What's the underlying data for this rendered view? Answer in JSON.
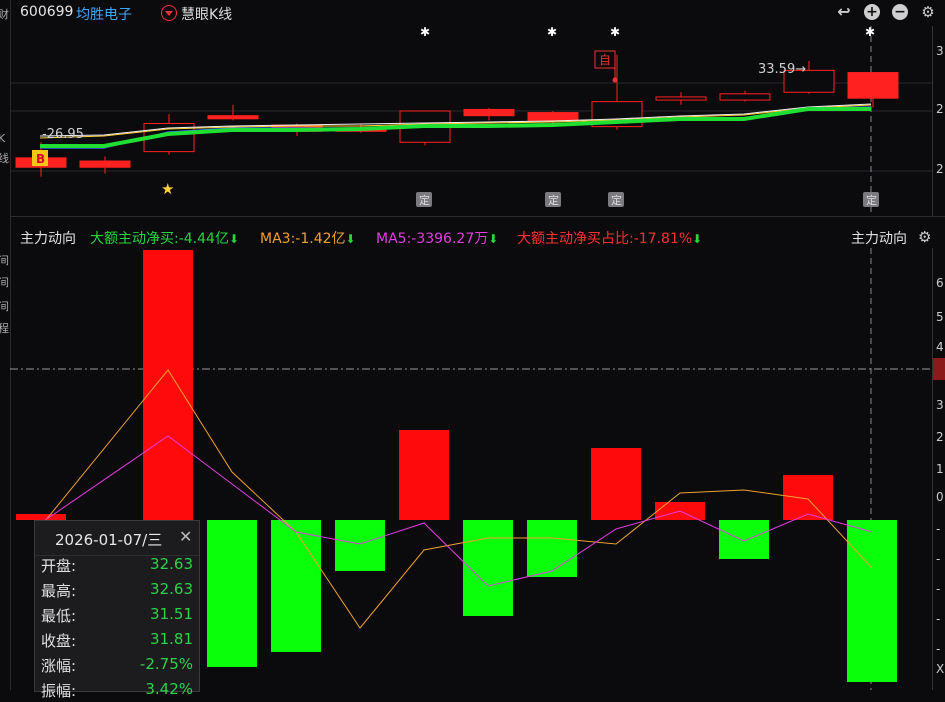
{
  "header": {
    "stock_code": "600699",
    "stock_name": "均胜电子",
    "kline_mode_label": "慧眼K线"
  },
  "left_strip": {
    "glyphs": [
      "财",
      "K",
      "线",
      "间",
      "间",
      "间",
      "程"
    ]
  },
  "kline": {
    "low_marker": "-26.95",
    "high_marker": "33.59→",
    "buy_badge": "B",
    "self_badge": "自",
    "event_badge": "定",
    "axis_labels": [
      "3",
      "2",
      "2"
    ],
    "candles": [
      {
        "o": 29.9,
        "c": 29.6,
        "h": 30.4,
        "l": 29.3
      },
      {
        "o": 29.8,
        "c": 29.6,
        "h": 29.95,
        "l": 29.4
      },
      {
        "o": 30.1,
        "c": 31.0,
        "h": 31.3,
        "l": 30.0
      },
      {
        "o": 31.25,
        "c": 31.15,
        "h": 31.6,
        "l": 31.1
      },
      {
        "o": 30.95,
        "c": 30.75,
        "h": 31.0,
        "l": 30.6
      },
      {
        "o": 30.85,
        "c": 30.75,
        "h": 31.0,
        "l": 30.7
      },
      {
        "o": 30.4,
        "c": 31.4,
        "h": 31.4,
        "l": 30.3
      },
      {
        "o": 31.45,
        "c": 31.25,
        "h": 31.5,
        "l": 31.1
      },
      {
        "o": 31.35,
        "c": 31.1,
        "h": 31.4,
        "l": 31.0
      },
      {
        "o": 30.9,
        "c": 31.7,
        "h": 33.2,
        "l": 30.8
      },
      {
        "o": 31.75,
        "c": 31.85,
        "h": 32.0,
        "l": 31.6
      },
      {
        "o": 31.75,
        "c": 31.95,
        "h": 32.05,
        "l": 31.7
      },
      {
        "o": 32.0,
        "c": 32.7,
        "h": 33.0,
        "l": 31.95
      },
      {
        "o": 32.63,
        "c": 31.81,
        "h": 32.63,
        "l": 31.51
      }
    ]
  },
  "indicator": {
    "title": "主力动向",
    "right_title": "主力动向",
    "net_buy_label": "大额主动净买:-4.44亿",
    "ma3_label": "MA3:-1.42亿",
    "ma5_label": "MA5:-3396.27万",
    "ratio_label": "大额主动净买占比:-17.81%",
    "axis_labels": [
      "6",
      "5",
      "4",
      "3",
      "2",
      "1",
      "0",
      "-",
      "-",
      "-",
      "-",
      "-",
      "X"
    ],
    "bars": [
      0.2,
      -4.7,
      -4.4,
      -1.7,
      3.0,
      -3.2,
      -1.9,
      2.4,
      0.6,
      -1.3,
      1.5,
      -5.4
    ],
    "first_bar_big": 9.0,
    "ma3": [
      2.4,
      0.8,
      -0.4,
      -3.6,
      -1.0,
      -0.6,
      -0.6,
      -0.8,
      0.3,
      0.4,
      0.2,
      -1.6
    ],
    "ma5": [
      1.6,
      0.9,
      -0.3,
      -0.8,
      -0.1,
      -2.2,
      -1.7,
      -0.3,
      0.1,
      -0.7,
      0.2,
      -0.4
    ]
  },
  "tooltip": {
    "date": "2026-01-07/三",
    "rows": [
      {
        "k": "开盘:",
        "v": "32.63"
      },
      {
        "k": "最高:",
        "v": "32.63"
      },
      {
        "k": "最低:",
        "v": "31.51"
      },
      {
        "k": "收盘:",
        "v": "31.81"
      },
      {
        "k": "涨幅:",
        "v": "-2.75%"
      },
      {
        "k": "振幅:",
        "v": "3.42%"
      }
    ]
  }
}
